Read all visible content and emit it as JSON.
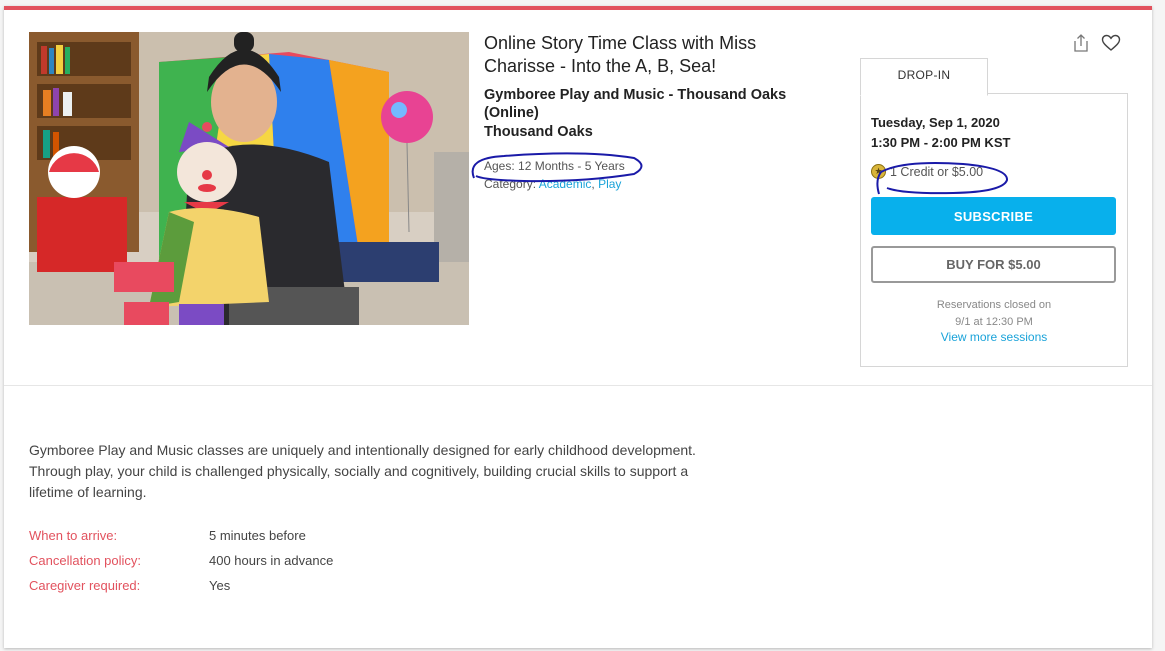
{
  "class": {
    "title": "Online Story Time Class with Miss Charisse - Into the A, B, Sea!",
    "organization": "Gymboree Play and Music - Thousand Oaks (Online)",
    "location": "Thousand Oaks",
    "ages": "Ages: 12 Months - 5 Years",
    "category_label": "Category:",
    "categories": [
      "Academic",
      "Play"
    ],
    "category_separator": ", "
  },
  "actions": {
    "share_icon": "share-icon",
    "favorite_icon": "heart-icon"
  },
  "booking": {
    "tab": "DROP-IN",
    "date": "Tuesday, Sep 1, 2020",
    "time": "1:30 PM - 2:00 PM KST",
    "price": "1 Credit or $5.00",
    "subscribe": "SUBSCRIBE",
    "buy": "BUY FOR $5.00",
    "closed_line1": "Reservations closed on",
    "closed_line2": "9/1 at 12:30 PM",
    "more_sessions": "View more sessions"
  },
  "description": "Gymboree Play and Music classes are uniquely and intentionally designed for early childhood development. Through play, your child is challenged physically, socially and cognitively, building crucial skills to support a lifetime of learning.",
  "details": [
    {
      "label": "When to arrive:",
      "value": "5 minutes before"
    },
    {
      "label": "Cancellation policy:",
      "value": "400 hours in advance"
    },
    {
      "label": "Caregiver required:",
      "value": "Yes"
    }
  ],
  "colors": {
    "accent": "#e2525e",
    "link": "#1aa3d9",
    "subscribe_button": "#08b0ec",
    "annotation_ink": "#1a1aa8"
  }
}
